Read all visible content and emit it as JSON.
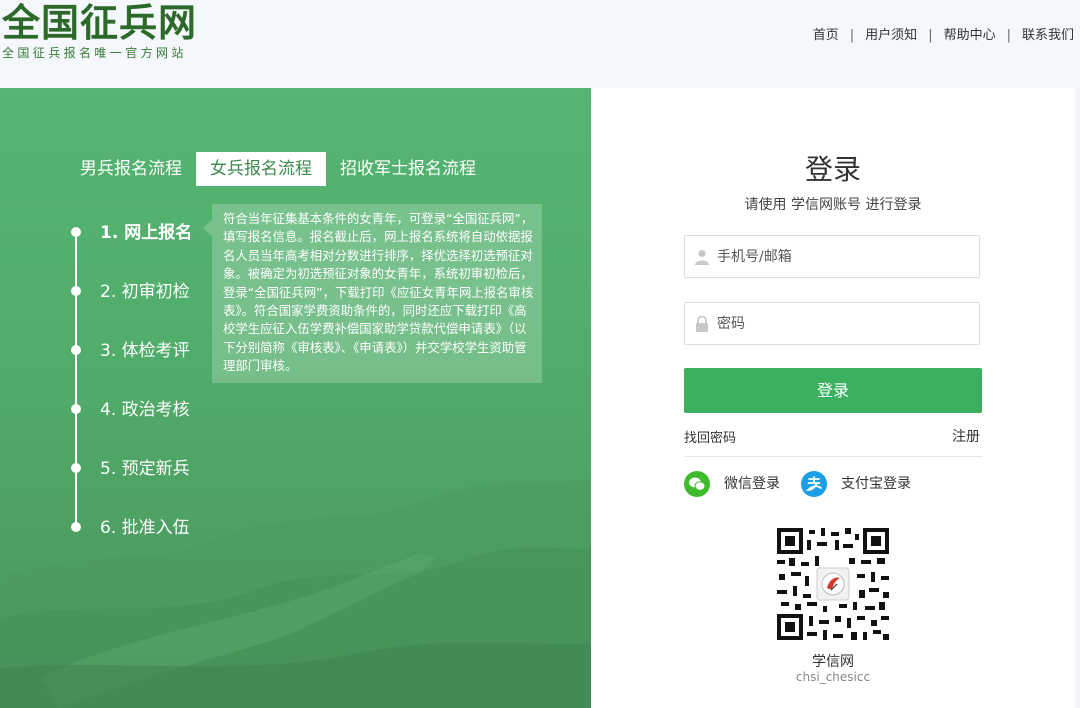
{
  "header": {
    "logo_title": "全国征兵网",
    "logo_subtitle": "全国征兵报名唯一官方网站",
    "nav": [
      "首页",
      "用户须知",
      "帮助中心",
      "联系我们"
    ]
  },
  "left": {
    "tabs": [
      {
        "label": "男兵报名流程",
        "active": false
      },
      {
        "label": "女兵报名流程",
        "active": true
      },
      {
        "label": "招收军士报名流程",
        "active": false
      }
    ],
    "steps": [
      "1. 网上报名",
      "2. 初审初检",
      "3. 体检考评",
      "4. 政治考核",
      "5. 预定新兵",
      "6. 批准入伍"
    ],
    "active_step": 0,
    "info": "符合当年征集基本条件的女青年，可登录“全国征兵网”，填写报名信息。报名截止后，网上报名系统将自动依据报名人员当年高考相对分数进行排序，择优选择初选预征对象。被确定为初选预征对象的女青年，系统初审初检后，登录“全国征兵网”，下载打印《应征女青年网上报名审核表》。符合国家学费资助条件的，同时还应下载打印《高校学生应征入伍学费补偿国家助学贷款代偿申请表》（以下分别简称《审核表》、《申请表》）并交学校学生资助管理部门审核。"
  },
  "login": {
    "title": "登录",
    "subtitle": "请使用  学信网账号  进行登录",
    "username_placeholder": "手机号/邮箱",
    "password_placeholder": "密码",
    "submit_label": "登录",
    "forgot_label": "找回密码",
    "register_label": "注册",
    "wechat_label": "微信登录",
    "alipay_label": "支付宝登录",
    "qr_name": "学信网",
    "qr_sub": "chsi_chesicc"
  },
  "colors": {
    "brand_green": "#3bb160",
    "panel_green": "#54b370",
    "logo_green": "#2d6a2a",
    "wechat": "#3dbb2c",
    "alipay": "#1a9ee6"
  },
  "icons": {
    "username": "user-icon",
    "password": "lock-icon",
    "wechat": "wechat-icon",
    "alipay": "alipay-icon"
  }
}
